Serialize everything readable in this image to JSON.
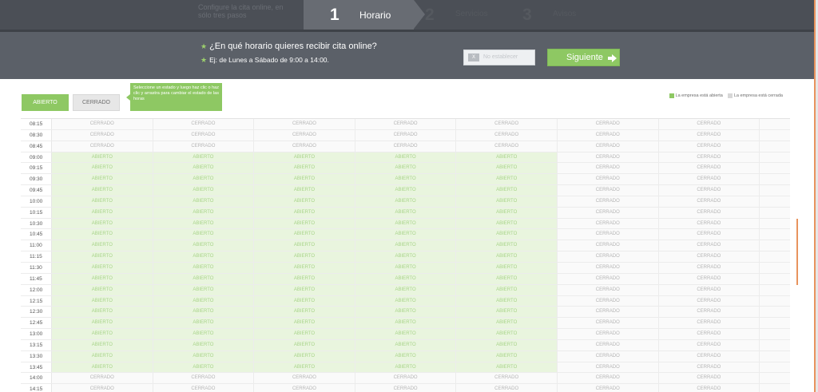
{
  "wizard": {
    "tagline": "Configure la cita online, en sólo tres pasos",
    "steps": [
      {
        "number": "1",
        "label": "Horario",
        "active": true
      },
      {
        "number": "2",
        "label": "Servicios",
        "active": false
      },
      {
        "number": "3",
        "label": "Avisos",
        "active": false
      }
    ]
  },
  "question": {
    "title": "¿En qué horario quieres recibir cita online?",
    "example": "Ej: de Lunes a Sábado de 9:00 a 14:00.",
    "star": "★"
  },
  "buttons": {
    "checkbox_mark": "X",
    "no_schedule": "No establecer",
    "next": "Siguiente"
  },
  "controls": {
    "open_label": "ABIERTO",
    "closed_label": "CERRADO",
    "tooltip": "Seleccione un estado y luego haz clic o haz clic y arrastra para cambiar el estado de las horas"
  },
  "legend": {
    "open": "La empresa está abierta",
    "closed": "La empresa está cerrada"
  },
  "colors": {
    "accent_green": "#8ec863",
    "header_dark": "#4b4f56",
    "header_mid": "#5b6068",
    "scroll_accent": "#e8935d"
  },
  "schedule": {
    "labels": {
      "open": "ABIERTO",
      "closed": "CERRADO"
    },
    "day_count": 7,
    "rows": [
      {
        "time": "08:15",
        "states": [
          "closed",
          "closed",
          "closed",
          "closed",
          "closed",
          "closed",
          "closed"
        ]
      },
      {
        "time": "08:30",
        "states": [
          "closed",
          "closed",
          "closed",
          "closed",
          "closed",
          "closed",
          "closed"
        ]
      },
      {
        "time": "08:45",
        "states": [
          "closed",
          "closed",
          "closed",
          "closed",
          "closed",
          "closed",
          "closed"
        ]
      },
      {
        "time": "09:00",
        "states": [
          "open",
          "open",
          "open",
          "open",
          "open",
          "closed",
          "closed"
        ]
      },
      {
        "time": "09:15",
        "states": [
          "open",
          "open",
          "open",
          "open",
          "open",
          "closed",
          "closed"
        ]
      },
      {
        "time": "09:30",
        "states": [
          "open",
          "open",
          "open",
          "open",
          "open",
          "closed",
          "closed"
        ]
      },
      {
        "time": "09:45",
        "states": [
          "open",
          "open",
          "open",
          "open",
          "open",
          "closed",
          "closed"
        ]
      },
      {
        "time": "10:00",
        "states": [
          "open",
          "open",
          "open",
          "open",
          "open",
          "closed",
          "closed"
        ]
      },
      {
        "time": "10:15",
        "states": [
          "open",
          "open",
          "open",
          "open",
          "open",
          "closed",
          "closed"
        ]
      },
      {
        "time": "10:30",
        "states": [
          "open",
          "open",
          "open",
          "open",
          "open",
          "closed",
          "closed"
        ]
      },
      {
        "time": "10:45",
        "states": [
          "open",
          "open",
          "open",
          "open",
          "open",
          "closed",
          "closed"
        ]
      },
      {
        "time": "11:00",
        "states": [
          "open",
          "open",
          "open",
          "open",
          "open",
          "closed",
          "closed"
        ]
      },
      {
        "time": "11:15",
        "states": [
          "open",
          "open",
          "open",
          "open",
          "open",
          "closed",
          "closed"
        ]
      },
      {
        "time": "11:30",
        "states": [
          "open",
          "open",
          "open",
          "open",
          "open",
          "closed",
          "closed"
        ]
      },
      {
        "time": "11:45",
        "states": [
          "open",
          "open",
          "open",
          "open",
          "open",
          "closed",
          "closed"
        ]
      },
      {
        "time": "12:00",
        "states": [
          "open",
          "open",
          "open",
          "open",
          "open",
          "closed",
          "closed"
        ]
      },
      {
        "time": "12:15",
        "states": [
          "open",
          "open",
          "open",
          "open",
          "open",
          "closed",
          "closed"
        ]
      },
      {
        "time": "12:30",
        "states": [
          "open",
          "open",
          "open",
          "open",
          "open",
          "closed",
          "closed"
        ]
      },
      {
        "time": "12:45",
        "states": [
          "open",
          "open",
          "open",
          "open",
          "open",
          "closed",
          "closed"
        ]
      },
      {
        "time": "13:00",
        "states": [
          "open",
          "open",
          "open",
          "open",
          "open",
          "closed",
          "closed"
        ]
      },
      {
        "time": "13:15",
        "states": [
          "open",
          "open",
          "open",
          "open",
          "open",
          "closed",
          "closed"
        ]
      },
      {
        "time": "13:30",
        "states": [
          "open",
          "open",
          "open",
          "open",
          "open",
          "closed",
          "closed"
        ]
      },
      {
        "time": "13:45",
        "states": [
          "open",
          "open",
          "open",
          "open",
          "open",
          "closed",
          "closed"
        ]
      },
      {
        "time": "14:00",
        "states": [
          "closed",
          "closed",
          "closed",
          "closed",
          "closed",
          "closed",
          "closed"
        ]
      },
      {
        "time": "14:15",
        "states": [
          "closed",
          "closed",
          "closed",
          "closed",
          "closed",
          "closed",
          "closed"
        ]
      }
    ]
  }
}
